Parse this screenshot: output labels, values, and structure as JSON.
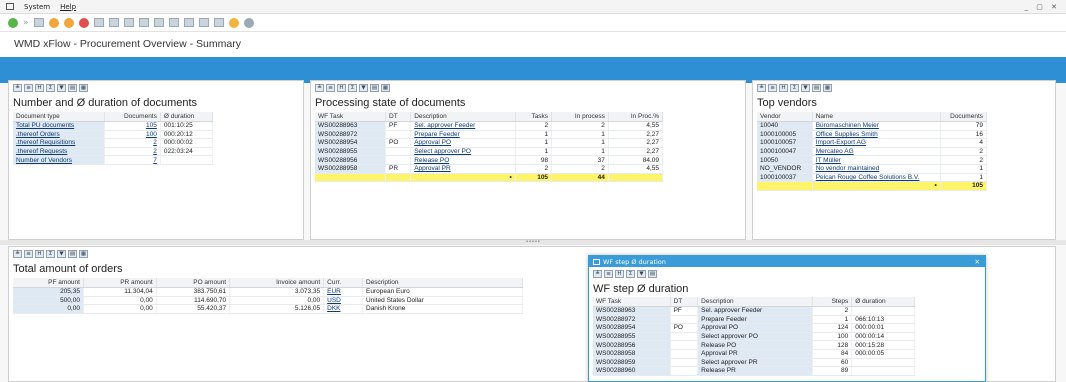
{
  "menu": {
    "system": "System",
    "help": "Help",
    "window_controls": "_ ▢ ✕"
  },
  "page_title": "WMD xFlow - Procurement Overview - Summary",
  "toolbar_icons": [
    "check-icon",
    "forward-icon",
    "save-icon",
    "back-icon",
    "exit-icon",
    "cancel-icon",
    "print-icon",
    "find-icon",
    "find-next-icon",
    "first-page-icon",
    "prev-page-icon",
    "next-page-icon",
    "last-page-icon",
    "layout-icon",
    "layout2-icon",
    "help-icon",
    "settings-icon"
  ],
  "docs_panel": {
    "title": "Number and Ø duration of documents",
    "headers": [
      "Document type",
      "Documents",
      "Ø duration"
    ],
    "rows": [
      [
        "Total PU documents",
        "105",
        "001:10:25"
      ],
      [
        ".thereof Orders",
        "100",
        "000:20:12"
      ],
      [
        ".thereof Requisitions",
        "2",
        "000:00:02"
      ],
      [
        ".thereof Requests",
        "2",
        "022:03:24"
      ],
      [
        "Number of Vendors",
        "7",
        ""
      ]
    ]
  },
  "processing_panel": {
    "title": "Processing state of documents",
    "headers": [
      "WF Task",
      "DT",
      "Description",
      "Tasks",
      "In process",
      "In Proc.%"
    ],
    "rows": [
      [
        "WS00288963",
        "PF",
        "Sel. approver Feeder",
        "2",
        "2",
        "4,55"
      ],
      [
        "WS00288972",
        "",
        "Prepare Feeder",
        "1",
        "1",
        "2,27"
      ],
      [
        "WS00288954",
        "PO",
        "Approval PO",
        "1",
        "1",
        "2,27"
      ],
      [
        "WS00288955",
        "",
        "Select approver PO",
        "1",
        "1",
        "2,27"
      ],
      [
        "WS00288956",
        "",
        "Release PO",
        "98",
        "37",
        "84,09"
      ],
      [
        "WS00288958",
        "PR",
        "Approval PR",
        "2",
        "2",
        "4,55"
      ]
    ],
    "total": {
      "tasks": "105",
      "in_process": "44",
      "marker": "•"
    }
  },
  "vendors_panel": {
    "title": "Top vendors",
    "headers": [
      "Vendor",
      "Name",
      "Documents"
    ],
    "rows": [
      [
        "10040",
        "Büromaschinen Meier",
        "79"
      ],
      [
        "1000100005",
        "Office Supplies Smith",
        "16"
      ],
      [
        "1000100057",
        "Import-Export AG",
        "4"
      ],
      [
        "1000100047",
        "Mercateo AG",
        "2"
      ],
      [
        "10050",
        "IT Müller",
        "2"
      ],
      [
        "NO_VENDOR",
        "No vendor maintained",
        "1"
      ],
      [
        "1000100037",
        "Pelcan Rouge Coffee Solutions B.V.",
        "1"
      ]
    ],
    "total": {
      "documents": "105",
      "marker": "•"
    }
  },
  "orders_panel": {
    "title": "Total amount of orders",
    "headers": [
      "PF amount",
      "PR amount",
      "PO amount",
      "Invoice amount",
      "Curr.",
      "Description"
    ],
    "rows": [
      [
        "205,35",
        "11.304,04",
        "383.750,61",
        "3.073,35",
        "EUR",
        "European Euro"
      ],
      [
        "500,00",
        "0,00",
        "114.690,70",
        "0,00",
        "USD",
        "United States Dollar"
      ],
      [
        "0,00",
        "0,00",
        "55.420,37",
        "5.126,05",
        "DKK",
        "Danish Krone"
      ]
    ]
  },
  "dialog": {
    "window_title": "WF step Ø duration",
    "title": "WF step Ø duration",
    "close": "✕",
    "headers": [
      "WF Task",
      "DT",
      "Description",
      "Steps",
      "Ø duration"
    ],
    "rows": [
      [
        "WS00288963",
        "PF",
        "Sel. approver Feeder",
        "2",
        ""
      ],
      [
        "WS00288972",
        "",
        "Prepare Feeder",
        "1",
        "066:10:13"
      ],
      [
        "WS00288954",
        "PO",
        "Approval PO",
        "124",
        "000:00:01"
      ],
      [
        "WS00288955",
        "",
        "Select approver PO",
        "100",
        "000:00:14"
      ],
      [
        "WS00288956",
        "",
        "Release PO",
        "128",
        "000:15:28"
      ],
      [
        "WS00288958",
        "",
        "Approval PR",
        "84",
        "000:00:05"
      ],
      [
        "WS00288959",
        "",
        "Select approver PR",
        "60",
        ""
      ],
      [
        "WS00288960",
        "",
        "Release PR",
        "89",
        ""
      ]
    ]
  },
  "splitter_dots": "•••••"
}
